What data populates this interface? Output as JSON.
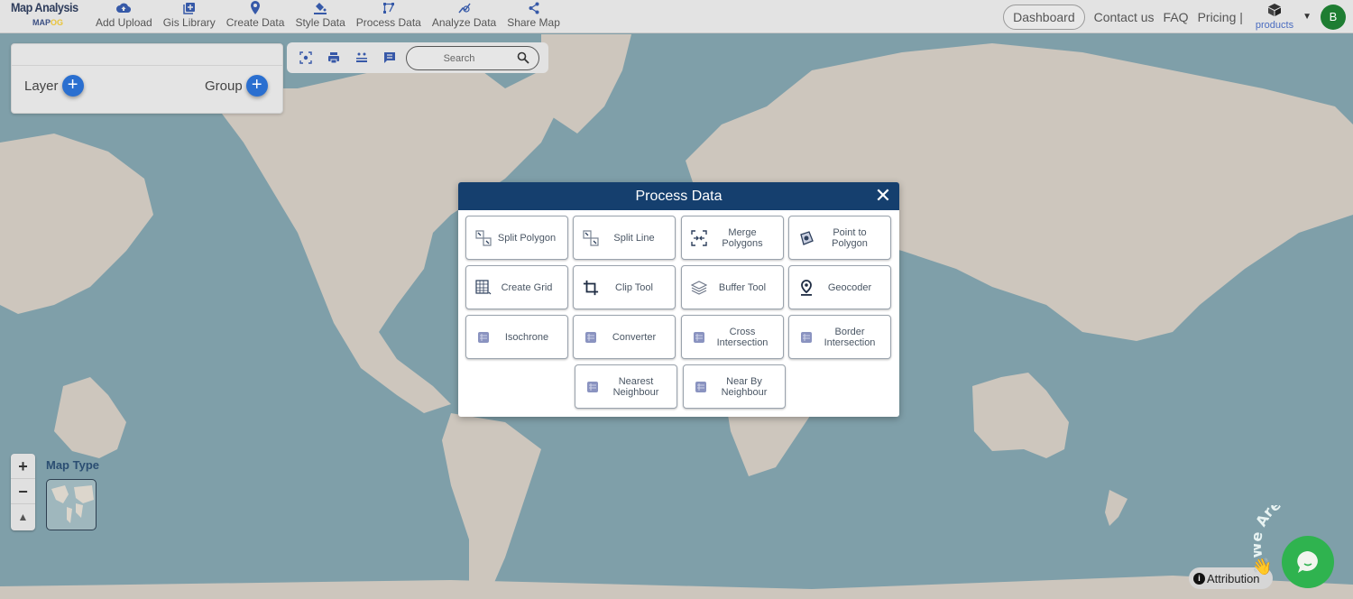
{
  "header": {
    "logo_title": "Map Analysis",
    "logo_sub_a": "MAP",
    "logo_sub_b": "OG",
    "nav": [
      {
        "label": "Add Upload",
        "icon": "cloud-upload-icon"
      },
      {
        "label": "Gis Library",
        "icon": "library-add-icon"
      },
      {
        "label": "Create Data",
        "icon": "map-pin-icon"
      },
      {
        "label": "Style Data",
        "icon": "paint-bucket-icon"
      },
      {
        "label": "Process Data",
        "icon": "process-nodes-icon"
      },
      {
        "label": "Analyze Data",
        "icon": "analyze-icon"
      },
      {
        "label": "Share Map",
        "icon": "share-icon"
      }
    ],
    "dashboard": "Dashboard",
    "contact": "Contact us",
    "faq": "FAQ",
    "pricing": "Pricing |",
    "products": "products",
    "avatar_initial": "B"
  },
  "layer_panel": {
    "layer_label": "Layer",
    "group_label": "Group"
  },
  "toolbar": {
    "search_placeholder": "Search"
  },
  "modal": {
    "title": "Process Data",
    "close": "✕",
    "tools": [
      {
        "label": "Split Polygon",
        "icon": "split-polygon-icon"
      },
      {
        "label": "Split Line",
        "icon": "split-line-icon"
      },
      {
        "label": "Merge Polygons",
        "icon": "merge-polygons-icon"
      },
      {
        "label": "Point to Polygon",
        "icon": "point-to-polygon-icon"
      },
      {
        "label": "Create Grid",
        "icon": "grid-icon"
      },
      {
        "label": "Clip Tool",
        "icon": "crop-icon"
      },
      {
        "label": "Buffer Tool",
        "icon": "layers-icon"
      },
      {
        "label": "Geocoder",
        "icon": "location-pin-icon"
      },
      {
        "label": "Isochrone",
        "icon": "isochrone-icon"
      },
      {
        "label": "Converter",
        "icon": "converter-icon"
      },
      {
        "label": "Cross Intersection",
        "icon": "cross-intersection-icon"
      },
      {
        "label": "Border Intersection",
        "icon": "border-intersection-icon"
      },
      {
        "label": "Nearest Neighbour",
        "icon": "nearest-neighbour-icon"
      },
      {
        "label": "Near By Neighbour",
        "icon": "nearby-neighbour-icon"
      }
    ]
  },
  "map_controls": {
    "zoom_in": "+",
    "zoom_out": "−",
    "reset_north": "▲",
    "map_type_label": "Map Type"
  },
  "attribution": "Attribution",
  "chat": {
    "banner": "We Are Here!"
  },
  "colors": {
    "brand_navy": "#153f6e",
    "accent_blue": "#2a6fd0",
    "chat_green": "#2fb34f",
    "avatar_green": "#1e7d32"
  }
}
